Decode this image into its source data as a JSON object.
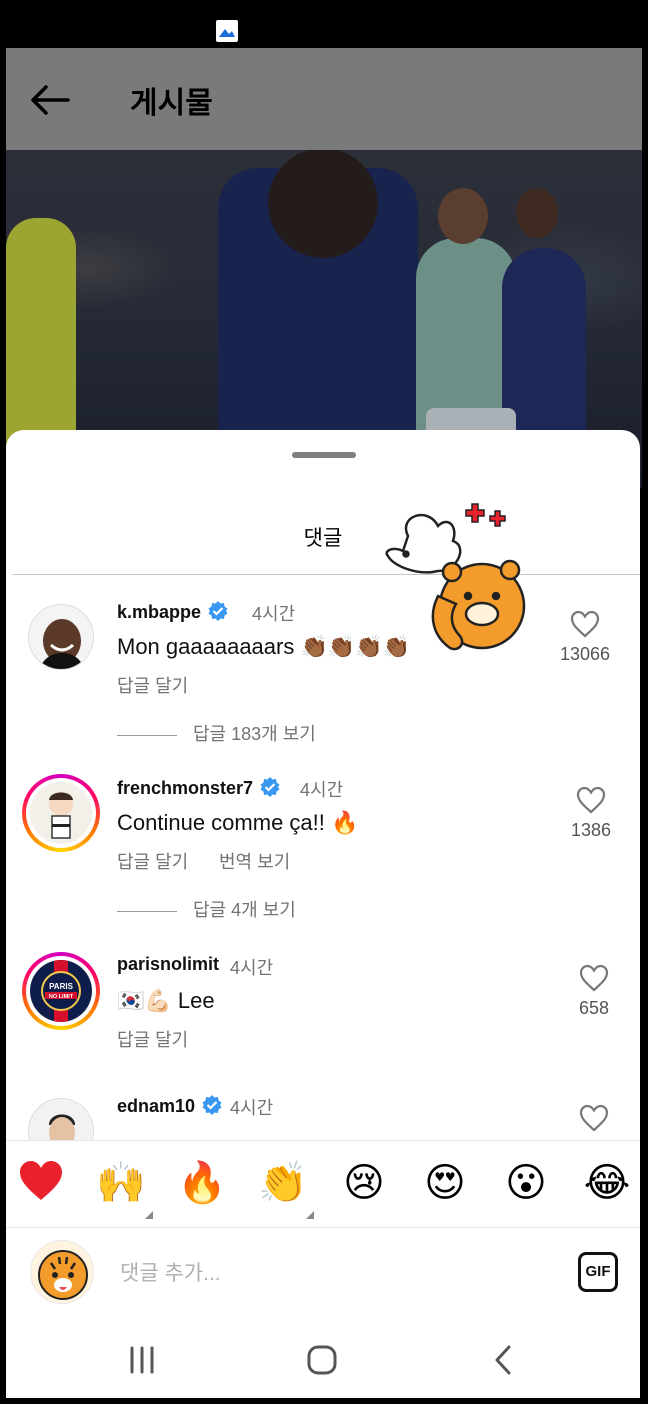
{
  "header": {
    "title": "게시물"
  },
  "sheet": {
    "title": "댓글"
  },
  "comments": [
    {
      "username": "k.mbappe",
      "verified": true,
      "time": "4시간",
      "text": "Mon gaaaaaaaars 👏🏾👏🏾👏🏾👏🏾",
      "reply": "답글 달기",
      "view_replies": "답글 183개 보기",
      "likes": "13066"
    },
    {
      "username": "frenchmonster7",
      "verified": true,
      "time": "4시간",
      "text": "Continue comme ça!! 🔥",
      "reply": "답글 달기",
      "translate": "번역 보기",
      "view_replies": "답글 4개 보기",
      "likes": "1386"
    },
    {
      "username": "parisnolimit",
      "verified": false,
      "time": "4시간",
      "text": "🇰🇷💪🏻 Lee",
      "reply": "답글 달기",
      "likes": "658",
      "avatar_text": "PARIS NO LIMIT"
    },
    {
      "username": "ednam10",
      "verified": true,
      "time": "4시간",
      "text": "",
      "likes": ""
    }
  ],
  "emoji_bar": [
    "❤️",
    "🙌",
    "🔥",
    "👏",
    "😢",
    "😍",
    "😮",
    "😂"
  ],
  "input": {
    "placeholder": "댓글 추가..."
  },
  "gif_label": "GIF",
  "colors": {
    "verified": "#3897f0",
    "heart": "#e8212c",
    "muted": "#737373"
  },
  "icons": [
    "back-arrow-icon",
    "heart-outline-icon",
    "verified-badge-icon",
    "gif-icon",
    "recent-apps-icon",
    "home-icon",
    "back-nav-icon"
  ]
}
